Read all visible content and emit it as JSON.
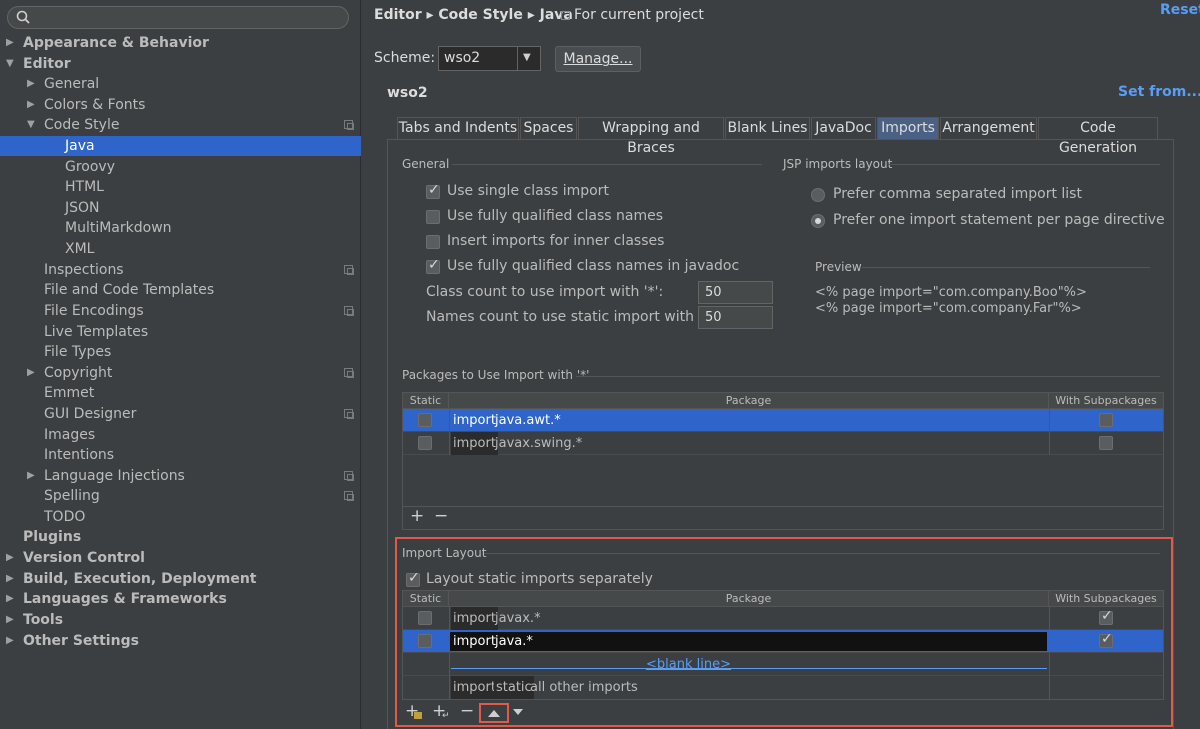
{
  "search": {
    "placeholder": "",
    "icon": "search-icon"
  },
  "sidebar": {
    "items": [
      {
        "label": "Appearance & Behavior"
      },
      {
        "label": "Editor"
      },
      {
        "label": "General"
      },
      {
        "label": "Colors & Fonts"
      },
      {
        "label": "Code Style"
      },
      {
        "label": "Java"
      },
      {
        "label": "Groovy"
      },
      {
        "label": "HTML"
      },
      {
        "label": "JSON"
      },
      {
        "label": "MultiMarkdown"
      },
      {
        "label": "XML"
      },
      {
        "label": "Inspections"
      },
      {
        "label": "File and Code Templates"
      },
      {
        "label": "File Encodings"
      },
      {
        "label": "Live Templates"
      },
      {
        "label": "File Types"
      },
      {
        "label": "Copyright"
      },
      {
        "label": "Emmet"
      },
      {
        "label": "GUI Designer"
      },
      {
        "label": "Images"
      },
      {
        "label": "Intentions"
      },
      {
        "label": "Language Injections"
      },
      {
        "label": "Spelling"
      },
      {
        "label": "TODO"
      },
      {
        "label": "Plugins"
      },
      {
        "label": "Version Control"
      },
      {
        "label": "Build, Execution, Deployment"
      },
      {
        "label": "Languages & Frameworks"
      },
      {
        "label": "Tools"
      },
      {
        "label": "Other Settings"
      }
    ]
  },
  "header": {
    "breadcrumb": "Editor ▸ Code Style ▸ Java",
    "scope": "For current project",
    "reset": "Reset"
  },
  "scheme": {
    "label": "Scheme:",
    "value": "wso2",
    "manage": "Manage...",
    "name": "wso2",
    "set_from": "Set from..."
  },
  "tabs": [
    {
      "label": "Tabs and Indents"
    },
    {
      "label": "Spaces"
    },
    {
      "label": "Wrapping and Braces"
    },
    {
      "label": "Blank Lines"
    },
    {
      "label": "JavaDoc"
    },
    {
      "label": "Imports"
    },
    {
      "label": "Arrangement"
    },
    {
      "label": "Code Generation"
    }
  ],
  "general": {
    "title": "General",
    "options": [
      {
        "label": "Use single class import",
        "checked": true
      },
      {
        "label": "Use fully qualified class names",
        "checked": false
      },
      {
        "label": "Insert imports for inner classes",
        "checked": false
      },
      {
        "label": "Use fully qualified class names in javadoc",
        "checked": true
      }
    ],
    "class_count_label": "Class count to use import with '*':",
    "class_count_value": "50",
    "names_count_label": "Names count to use static import with '*':",
    "names_count_value": "50"
  },
  "jsp": {
    "title": "JSP imports layout",
    "opt1": "Prefer comma separated import list",
    "opt2": "Prefer one import statement per page directive",
    "preview_title": "Preview",
    "preview1": "<% page import=\"com.company.Boo\"%>",
    "preview2": "<% page import=\"com.company.Far\"%>"
  },
  "packages": {
    "title": "Packages to Use Import with '*'",
    "col_static": "Static",
    "col_package": "Package",
    "col_sub": "With Subpackages",
    "rows": [
      {
        "kw": "import",
        "pkg": "java.awt.*"
      },
      {
        "kw": "import",
        "pkg": "javax.swing.*"
      }
    ],
    "add": "+",
    "remove": "−"
  },
  "layout": {
    "title": "Import Layout",
    "static_sep": "Layout static imports separately",
    "col_static": "Static",
    "col_package": "Package",
    "col_sub": "With Subpackages",
    "rows": [
      {
        "kw": "import",
        "pkg": "javax.*"
      },
      {
        "kw": "import",
        "pkg": "java.*"
      }
    ],
    "blank_line": "<blank line>",
    "other_kw1": "import",
    "other_kw2": "static",
    "other_text": "all other imports",
    "add_pkg": "+",
    "add_blank": "+",
    "remove": "−",
    "highlight_color": "#e05a4a"
  }
}
